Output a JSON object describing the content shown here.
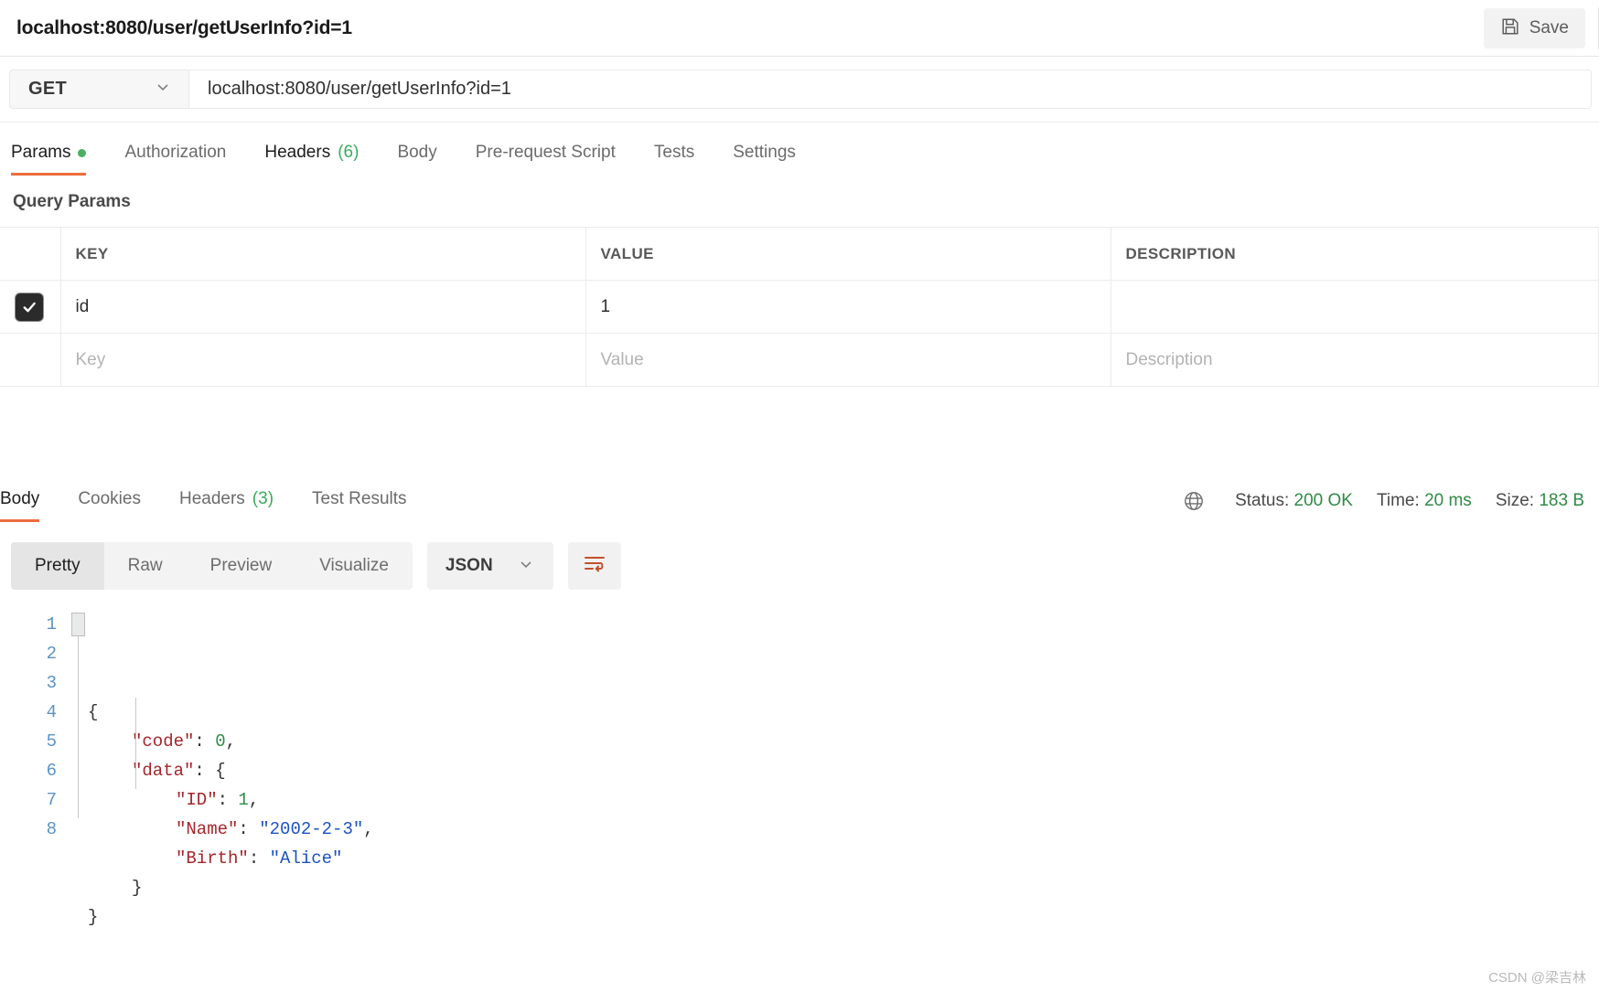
{
  "topbar": {
    "request_title": "localhost:8080/user/getUserInfo?id=1",
    "save_label": "Save",
    "save_icon": "floppy-disk-icon"
  },
  "urlbar": {
    "method": "GET",
    "method_caret": "chevron-down-icon",
    "url": "localhost:8080/user/getUserInfo?id=1"
  },
  "request_tabs": [
    {
      "label": "Params",
      "active": true,
      "dot": true
    },
    {
      "label": "Authorization",
      "active": false
    },
    {
      "label": "Headers",
      "count": "(6)",
      "active": false
    },
    {
      "label": "Body",
      "active": false
    },
    {
      "label": "Pre-request Script",
      "active": false
    },
    {
      "label": "Tests",
      "active": false
    },
    {
      "label": "Settings",
      "active": false
    }
  ],
  "query_params": {
    "title": "Query Params",
    "columns": [
      "KEY",
      "VALUE",
      "DESCRIPTION"
    ],
    "rows": [
      {
        "checked": true,
        "key": "id",
        "value": "1",
        "description": ""
      }
    ],
    "new_row_placeholders": {
      "key": "Key",
      "value": "Value",
      "description": "Description"
    }
  },
  "response": {
    "tabs": [
      {
        "label": "Body",
        "active": true
      },
      {
        "label": "Cookies",
        "active": false
      },
      {
        "label": "Headers",
        "count": "(3)",
        "active": false
      },
      {
        "label": "Test Results",
        "active": false
      }
    ],
    "meta": {
      "globe_icon": "globe-icon",
      "status_label": "Status:",
      "status_value": "200 OK",
      "time_label": "Time:",
      "time_value": "20 ms",
      "size_label": "Size:",
      "size_value": "183 B"
    },
    "view_modes": [
      {
        "label": "Pretty",
        "active": true
      },
      {
        "label": "Raw",
        "active": false
      },
      {
        "label": "Preview",
        "active": false
      },
      {
        "label": "Visualize",
        "active": false
      }
    ],
    "format_select": {
      "value": "JSON",
      "caret": "chevron-down-icon"
    },
    "wrap_button_icon": "wrap-lines-icon",
    "body_lines": [
      {
        "n": "1",
        "indent": 0,
        "tokens": [
          {
            "t": "{",
            "c": "punct"
          }
        ]
      },
      {
        "n": "2",
        "indent": 1,
        "tokens": [
          {
            "t": "\"code\"",
            "c": "key"
          },
          {
            "t": ": ",
            "c": "punct"
          },
          {
            "t": "0",
            "c": "num"
          },
          {
            "t": ",",
            "c": "punct"
          }
        ]
      },
      {
        "n": "3",
        "indent": 1,
        "tokens": [
          {
            "t": "\"data\"",
            "c": "key"
          },
          {
            "t": ": ",
            "c": "punct"
          },
          {
            "t": "{",
            "c": "punct"
          }
        ]
      },
      {
        "n": "4",
        "indent": 2,
        "tokens": [
          {
            "t": "\"ID\"",
            "c": "key"
          },
          {
            "t": ": ",
            "c": "punct"
          },
          {
            "t": "1",
            "c": "num"
          },
          {
            "t": ",",
            "c": "punct"
          }
        ]
      },
      {
        "n": "5",
        "indent": 2,
        "tokens": [
          {
            "t": "\"Name\"",
            "c": "key"
          },
          {
            "t": ": ",
            "c": "punct"
          },
          {
            "t": "\"2002-2-3\"",
            "c": "str"
          },
          {
            "t": ",",
            "c": "punct"
          }
        ]
      },
      {
        "n": "6",
        "indent": 2,
        "tokens": [
          {
            "t": "\"Birth\"",
            "c": "key"
          },
          {
            "t": ": ",
            "c": "punct"
          },
          {
            "t": "\"Alice\"",
            "c": "str"
          }
        ]
      },
      {
        "n": "7",
        "indent": 1,
        "tokens": [
          {
            "t": "}",
            "c": "punct"
          }
        ]
      },
      {
        "n": "8",
        "indent": 0,
        "tokens": [
          {
            "t": "}",
            "c": "punct"
          }
        ]
      }
    ]
  },
  "watermark": "CSDN @梁吉林",
  "colors": {
    "accent_orange": "#ef6c3e",
    "status_green": "#2e8b45",
    "tab_count_green": "#3aab5c",
    "string_blue": "#1a52c4",
    "key_red": "#a4262c",
    "line_number_blue": "#5b93c4"
  }
}
